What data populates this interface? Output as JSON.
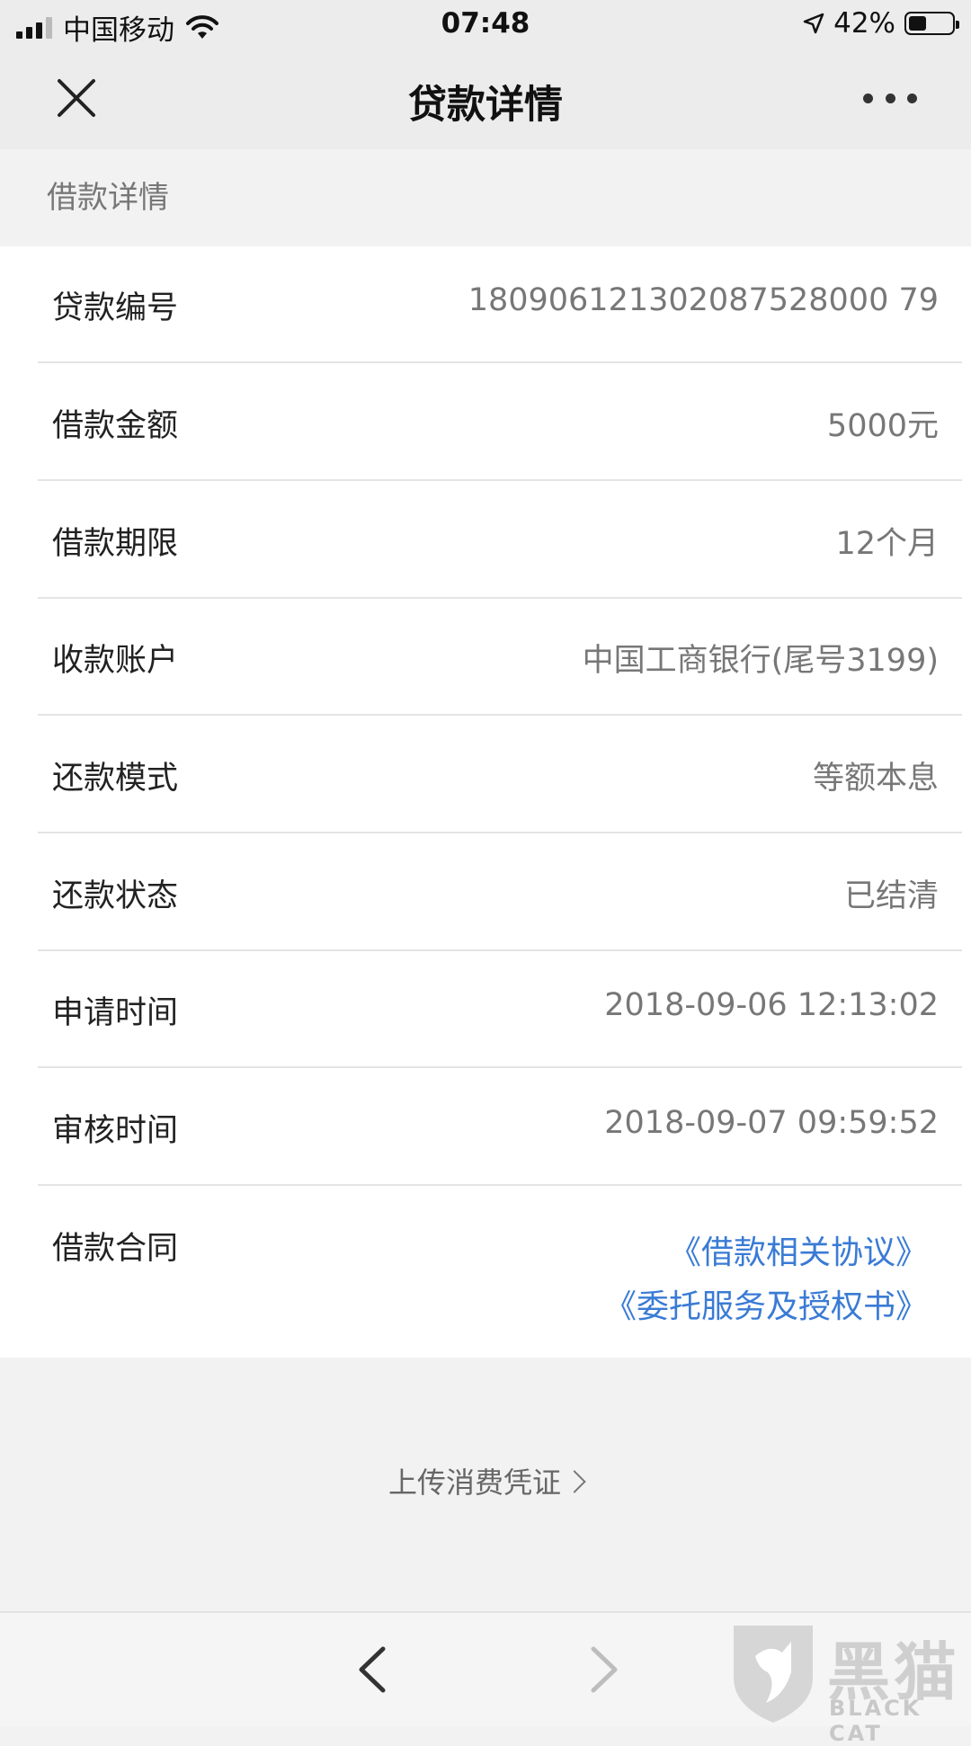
{
  "status_bar": {
    "carrier": "中国移动",
    "time": "07:48",
    "battery_percent": "42%",
    "battery_level": 0.42
  },
  "nav": {
    "title": "贷款详情",
    "close_icon": "close-icon",
    "more_icon": "more-icon"
  },
  "section": {
    "header": "借款详情"
  },
  "rows": [
    {
      "label": "贷款编号",
      "value": "180906121302087528000 79"
    },
    {
      "label": "借款金额",
      "value": "5000元"
    },
    {
      "label": "借款期限",
      "value": "12个月"
    },
    {
      "label": "收款账户",
      "value": "中国工商银行(尾号3199)"
    },
    {
      "label": "还款模式",
      "value": "等额本息"
    },
    {
      "label": "还款状态",
      "value": "已结清"
    },
    {
      "label": "申请时间",
      "value": "2018-09-06 12:13:02"
    },
    {
      "label": "审核时间",
      "value": "2018-09-07 09:59:52"
    }
  ],
  "contract": {
    "label": "借款合同",
    "links": [
      "《借款相关协议》",
      "《委托服务及授权书》"
    ]
  },
  "upload": {
    "label": "上传消费凭证"
  },
  "watermark": {
    "brand": "黑猫",
    "brand_en": "BLACK CAT"
  },
  "colors": {
    "link": "#3a7bd5",
    "label": "#222222",
    "value": "#777777",
    "background": "#f2f2f2"
  }
}
